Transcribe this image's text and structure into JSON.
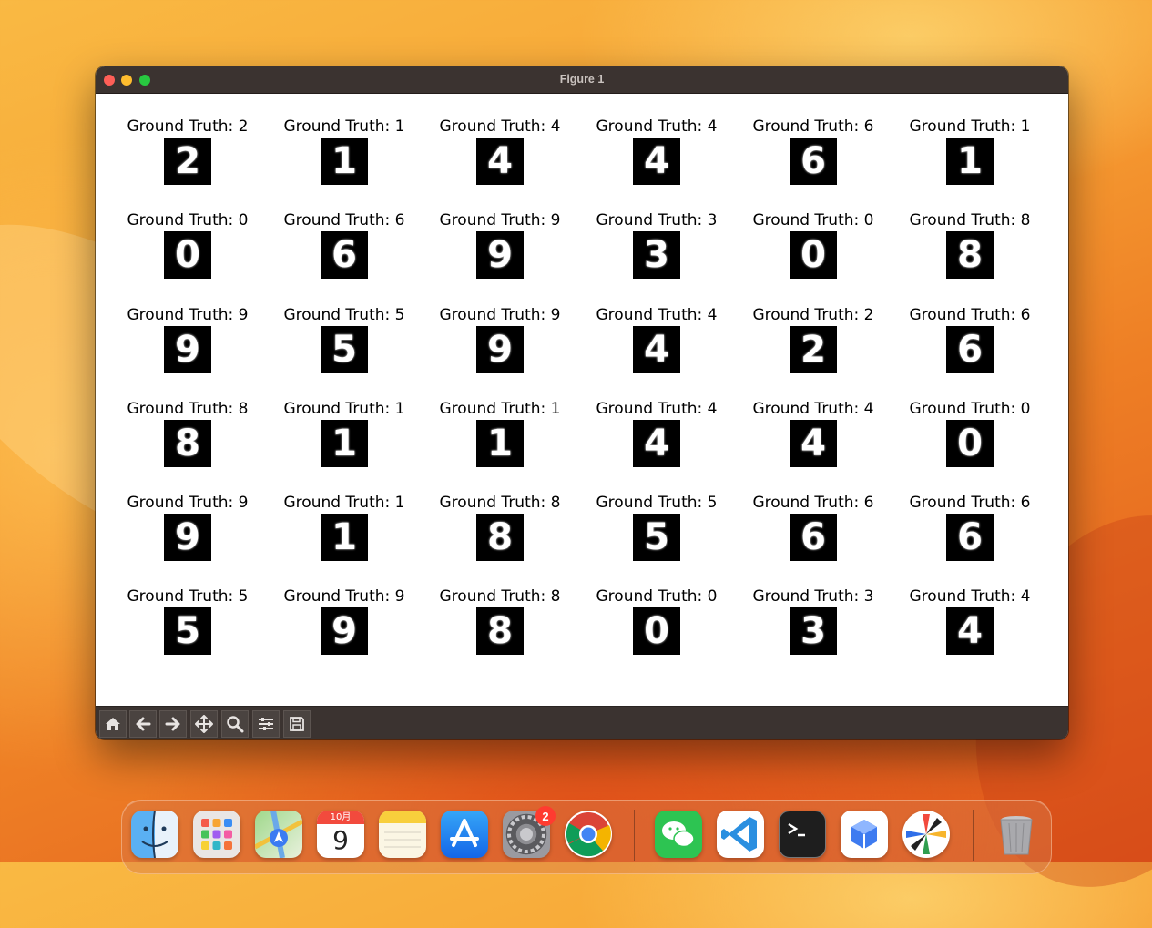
{
  "window": {
    "title": "Figure 1"
  },
  "figure": {
    "title_prefix": "Ground Truth: ",
    "grid": [
      [
        "2",
        "1",
        "4",
        "4",
        "6",
        "1"
      ],
      [
        "0",
        "6",
        "9",
        "3",
        "0",
        "8"
      ],
      [
        "9",
        "5",
        "9",
        "4",
        "2",
        "6"
      ],
      [
        "8",
        "1",
        "1",
        "4",
        "4",
        "0"
      ],
      [
        "9",
        "1",
        "8",
        "5",
        "6",
        "6"
      ],
      [
        "5",
        "9",
        "8",
        "0",
        "3",
        "4"
      ]
    ]
  },
  "toolbar": {
    "buttons": [
      "home-icon",
      "back-arrow-icon",
      "forward-arrow-icon",
      "pan-icon",
      "zoom-icon",
      "configure-subplots-icon",
      "save-icon"
    ]
  },
  "dock": {
    "apps": [
      {
        "name": "Finder",
        "icon": "finder-icon"
      },
      {
        "name": "Launchpad",
        "icon": "launchpad-icon"
      },
      {
        "name": "Maps",
        "icon": "maps-icon"
      },
      {
        "name": "Calendar",
        "icon": "calendar-icon",
        "month": "10月",
        "day": "9"
      },
      {
        "name": "Notes",
        "icon": "notes-icon"
      },
      {
        "name": "App Store",
        "icon": "app-store-icon"
      },
      {
        "name": "System Settings",
        "icon": "system-settings-icon",
        "badge": "2"
      },
      {
        "name": "Chrome",
        "icon": "chrome-icon"
      },
      {
        "name": "WeChat",
        "icon": "wechat-icon"
      },
      {
        "name": "Visual Studio Code",
        "icon": "vscode-icon"
      },
      {
        "name": "Terminal",
        "icon": "terminal-icon"
      },
      {
        "name": "Installer",
        "icon": "installer-icon"
      },
      {
        "name": "Pinwheel",
        "icon": "pinwheel-icon"
      },
      {
        "name": "Trash",
        "icon": "trash-icon"
      }
    ]
  },
  "colors": {
    "titlebar": "#3b3330",
    "toolbar": "#3b3330",
    "close": "#fe5f57",
    "minimize": "#febc2e",
    "maximize": "#28c840",
    "badge": "#ff3b30"
  }
}
